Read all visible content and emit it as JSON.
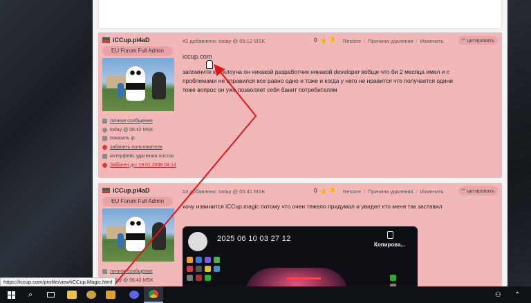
{
  "colors": {
    "post_bg": "#f2b8b8",
    "badge_bg": "#e8a4a4",
    "banned_red": "#c0272d",
    "arrow_red": "#e0151b",
    "taskbar": "#0e1216"
  },
  "posts": [
    {
      "nick": "iCCup.pi4aD",
      "role": "EU Forum Full Admin",
      "meta": "#2 добавлено: today @ 05:12 MSK",
      "score": "0",
      "restore": "Restore",
      "delete_reason": "Причина удаления",
      "edit": "Изменить",
      "quote": "\"\" цитировать",
      "link_text": "iccup.com",
      "text": "запомните как клоуна он никакой разработчик никакой developer вобще что би 2 месяца имел и с проблемами не справился все равно одно и тоже и когда у него не нравится что получается одини тоже вопрос он уже позволяет себя банит потребителям",
      "actions": {
        "pm": "личное сообщение",
        "time": "today @ 06:42 MSK",
        "show_ip": "показать ip",
        "ban_user": "забанить пользователя",
        "delete_iface": "интерфейс удаления постов",
        "banned_until": "Забанен до: 19.01.2038 04:14"
      }
    },
    {
      "nick": "iCCup.pi4aD",
      "role": "EU Forum Full Admin",
      "meta": "#3 добавлено: today @ 05:41 MSK",
      "score": "0",
      "restore": "Restore",
      "delete_reason": "Причина удаления",
      "edit": "Изменить",
      "quote": "\"\" цитировать",
      "text": "хочу извинится iCCup.magic потому что очен тяжело придумал и увидел кто меня так заставил",
      "image": {
        "timestamp": "2025 06 10 03 27 12",
        "copy_label": "Копирова..."
      },
      "actions": {
        "pm": "личное сообщение",
        "time": "today @ 06:42 MSK"
      }
    }
  ],
  "status_url": "https://iccup.com/profile/view/iCCup.Magic.html",
  "taskbar": {
    "icons": [
      "windows-start-icon",
      "search-icon",
      "task-view-icon",
      "file-explorer-icon",
      "game-icon",
      "media-player-icon",
      "discord-icon",
      "chrome-icon"
    ]
  }
}
